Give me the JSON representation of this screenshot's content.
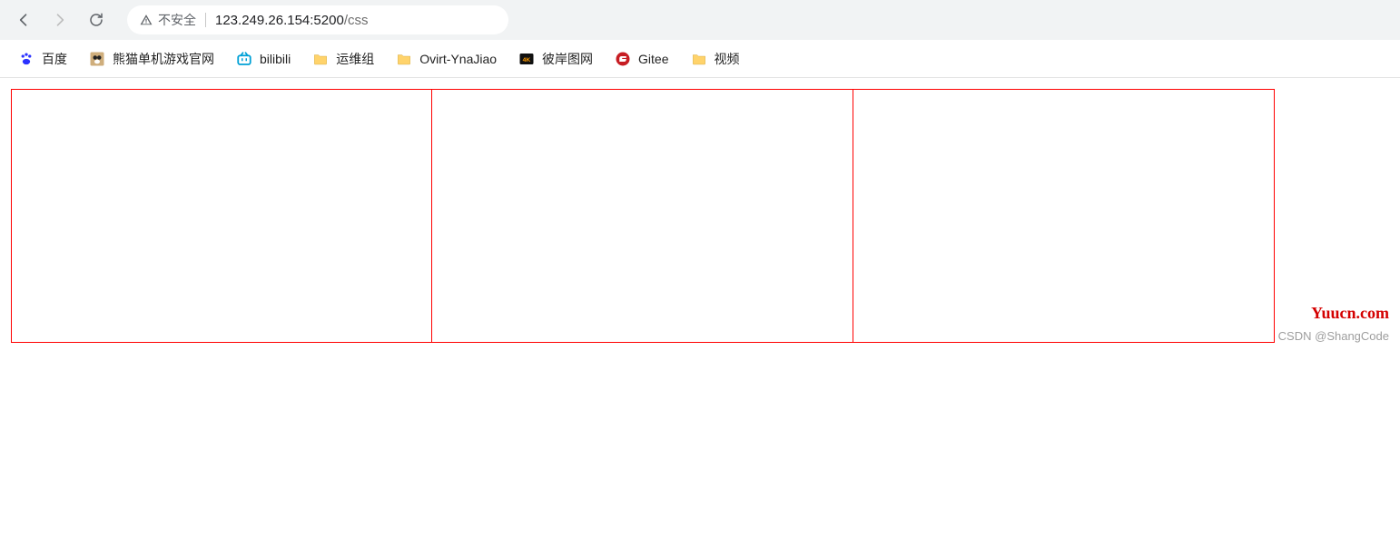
{
  "toolbar": {
    "security_label": "不安全",
    "url_host": "123.249.26.154:5200",
    "url_path": "/css"
  },
  "bookmarks": [
    {
      "id": "baidu",
      "label": "百度",
      "kind": "baidu"
    },
    {
      "id": "panda",
      "label": "熊猫单机游戏官网",
      "kind": "image"
    },
    {
      "id": "bili",
      "label": "bilibili",
      "kind": "bili"
    },
    {
      "id": "ops",
      "label": "运维组",
      "kind": "folder"
    },
    {
      "id": "ovirt",
      "label": "Ovirt-YnaJiao",
      "kind": "folder"
    },
    {
      "id": "4k",
      "label": "彼岸图网",
      "kind": "4k"
    },
    {
      "id": "gitee",
      "label": "Gitee",
      "kind": "gitee"
    },
    {
      "id": "video",
      "label": "视频",
      "kind": "folder"
    }
  ],
  "content": {
    "columns": 3
  },
  "watermarks": {
    "site": "Yuucn.com",
    "author": "CSDN @ShangCode"
  }
}
